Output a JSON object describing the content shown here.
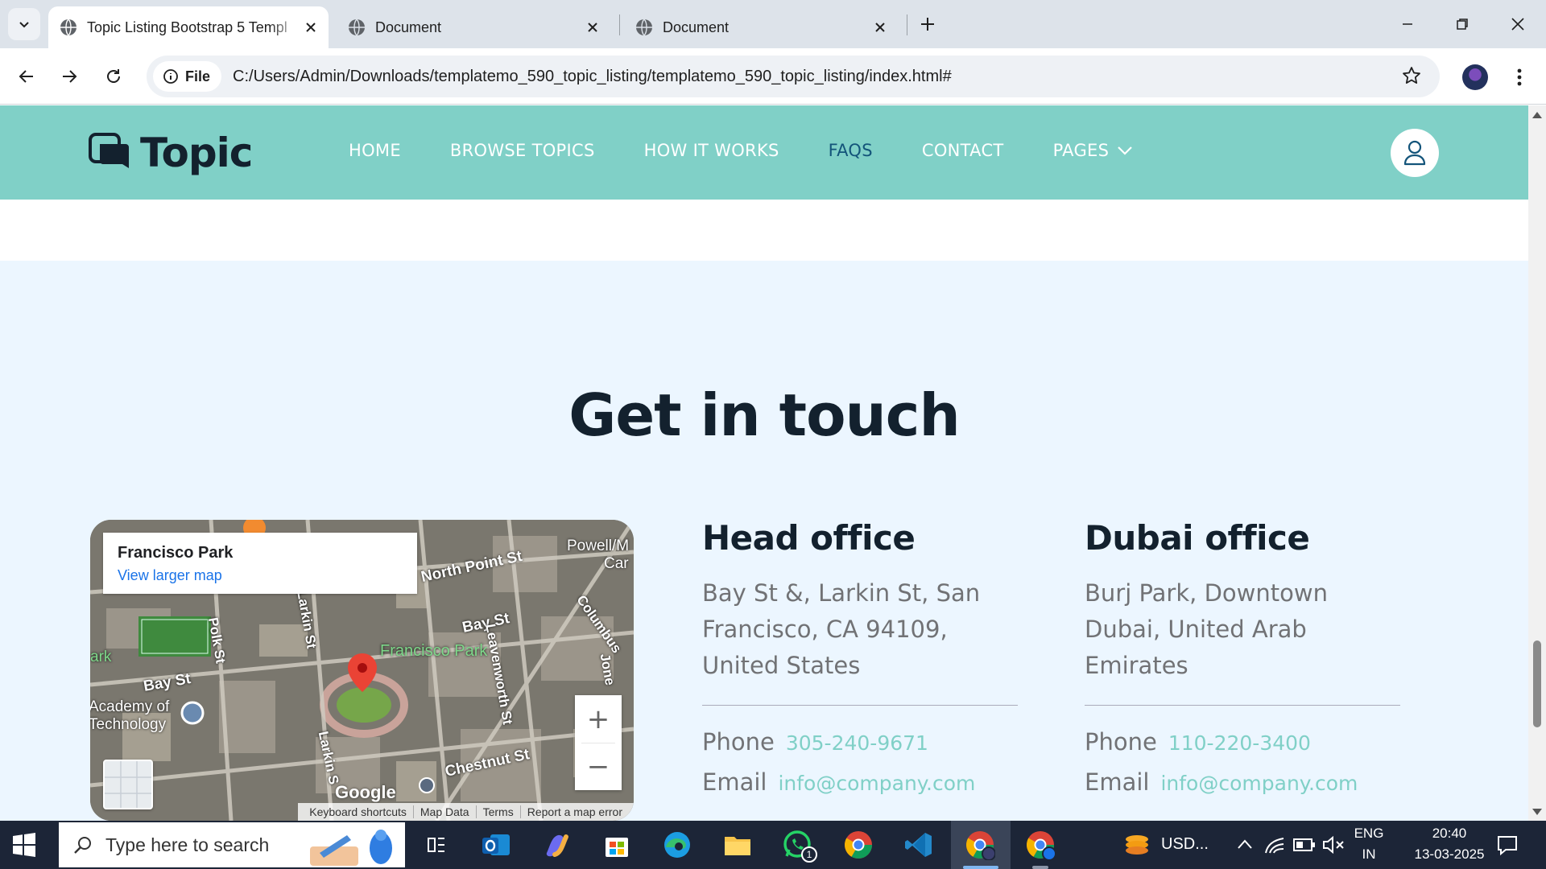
{
  "browser": {
    "tabs": [
      {
        "title": "Topic Listing Bootstrap 5 Templ",
        "active": true
      },
      {
        "title": "Document",
        "active": false
      },
      {
        "title": "Document",
        "active": false
      }
    ],
    "address": {
      "scheme_label": "File",
      "url": "C:/Users/Admin/Downloads/templatemo_590_topic_listing/templatemo_590_topic_listing/index.html#"
    }
  },
  "site": {
    "brand": "Topic",
    "nav": [
      {
        "label": "HOME"
      },
      {
        "label": "BROWSE TOPICS"
      },
      {
        "label": "HOW IT WORKS"
      },
      {
        "label": "FAQS"
      },
      {
        "label": "CONTACT"
      },
      {
        "label": "PAGES"
      }
    ],
    "active_nav": "FAQS",
    "accent_color": "#80d0c7",
    "nav_bg_color": "#80d0c7"
  },
  "contact": {
    "title": "Get in touch",
    "map": {
      "place": "Francisco Park",
      "link": "View larger map",
      "labels": {
        "north_point": "North Point St",
        "powell": "Powell/M",
        "car": "Car",
        "francisco_park": "Francisco Park",
        "bay_st": "Bay St",
        "bay_st_2": "Bay St",
        "polk": "Polk St",
        "larkin": "Larkin St",
        "larkin_2": "Larkin S",
        "leavenworth": "Leavenworth St",
        "columbus": "Columbus",
        "jones": "Jone",
        "chestnut": "Chestnut St",
        "academy_1": "Academy of",
        "academy_2": "Technology",
        "park": "ark"
      },
      "google": "Google",
      "footer": [
        "Keyboard shortcuts",
        "Map Data",
        "Terms",
        "Report a map error"
      ]
    },
    "offices": [
      {
        "name": "Head office",
        "address": "Bay St &, Larkin St, San Francisco, CA 94109, United States",
        "phone_label": "Phone",
        "phone": "305-240-9671",
        "email_label": "Email",
        "email": "info@company.com"
      },
      {
        "name": "Dubai office",
        "address": "Burj Park, Downtown Dubai, United Arab Emirates",
        "phone_label": "Phone",
        "phone": "110-220-3400",
        "email_label": "Email",
        "email": "info@company.com"
      }
    ]
  },
  "taskbar": {
    "search_placeholder": "Type here to search",
    "whatsapp_badge": "1",
    "weather": "USD...",
    "lang_1": "ENG",
    "lang_2": "IN",
    "time": "20:40",
    "date": "13-03-2025"
  }
}
